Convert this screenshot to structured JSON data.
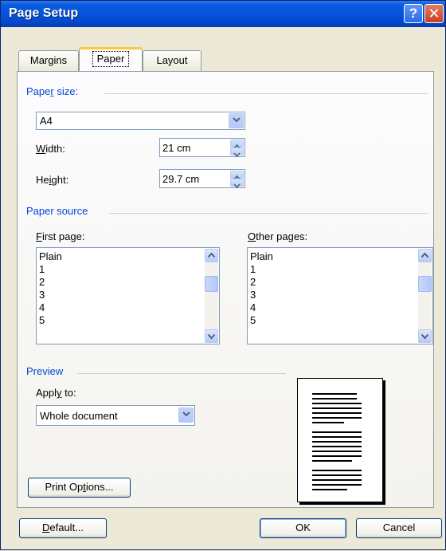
{
  "window": {
    "title": "Page Setup",
    "help_glyph": "?",
    "close_glyph": "✕"
  },
  "tabs": [
    {
      "label": "Margins",
      "active": false
    },
    {
      "label": "Paper",
      "active": true
    },
    {
      "label": "Layout",
      "active": false
    }
  ],
  "paper_size": {
    "group_label_pre": "Pape",
    "group_label_key": "r",
    "group_label_post": " size:",
    "selected": "A4",
    "width_label_key": "W",
    "width_label_post": "idth:",
    "width_value": "21 cm",
    "height_label_pre": "He",
    "height_label_key": "i",
    "height_label_post": "ght:",
    "height_value": "29.7 cm"
  },
  "paper_source": {
    "group_label": "Paper source",
    "first_page_label_key": "F",
    "first_page_label_post": "irst page:",
    "other_pages_label_key": "O",
    "other_pages_label_post": "ther pages:",
    "first_page_items": [
      "Plain",
      "1",
      "2",
      "3",
      "4",
      "5"
    ],
    "other_pages_items": [
      "Plain",
      "1",
      "2",
      "3",
      "4",
      "5"
    ]
  },
  "preview": {
    "group_label": "Preview",
    "apply_to_label_pre": "Appl",
    "apply_to_label_key": "y",
    "apply_to_label_post": " to:",
    "apply_to_value": "Whole document"
  },
  "buttons": {
    "print_options_pre": "Print Op",
    "print_options_key": "t",
    "print_options_post": "ions...",
    "default_key": "D",
    "default_post": "efault...",
    "ok": "OK",
    "cancel": "Cancel"
  },
  "icons": [
    "help-icon",
    "close-icon",
    "chevron-down-icon",
    "spin-up-icon",
    "spin-down-icon",
    "scroll-up-icon",
    "scroll-down-icon"
  ]
}
